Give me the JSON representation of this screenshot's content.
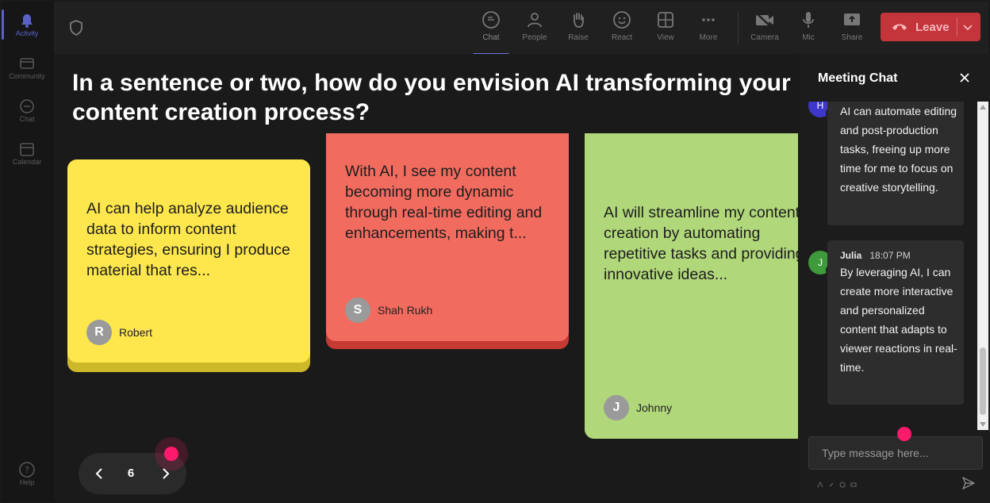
{
  "rail": {
    "items": [
      {
        "label": "Activity",
        "icon": "bell-icon",
        "active": true
      },
      {
        "label": "Community",
        "icon": "community-icon",
        "active": false
      },
      {
        "label": "Chat",
        "icon": "chat-icon",
        "active": false
      },
      {
        "label": "Calendar",
        "icon": "calendar-icon",
        "active": false
      }
    ],
    "help_label": "Help"
  },
  "toolbar": {
    "items": [
      {
        "label": "Chat",
        "icon": "chat-icon",
        "active": true
      },
      {
        "label": "People",
        "icon": "people-icon",
        "active": false
      },
      {
        "label": "Raise",
        "icon": "raise-hand-icon",
        "active": false
      },
      {
        "label": "React",
        "icon": "smiley-icon",
        "active": false
      },
      {
        "label": "View",
        "icon": "grid-icon",
        "active": false
      },
      {
        "label": "More",
        "icon": "more-dots-icon",
        "active": false
      },
      {
        "label": "Camera",
        "icon": "camera-off-icon",
        "active": false
      },
      {
        "label": "Mic",
        "icon": "mic-icon",
        "active": false
      },
      {
        "label": "Share",
        "icon": "share-icon",
        "active": false
      }
    ],
    "leave_label": "Leave"
  },
  "main": {
    "question": "In a sentence or two, how do you envision AI transforming your content creation process?",
    "cards": [
      {
        "text": "AI can help analyze audience data to inform content strategies, ensuring I produce material that res...",
        "author": "Robert",
        "initial": "R",
        "color": "#fde74c"
      },
      {
        "text": "With AI, I see my content becoming more dynamic through real-time editing and enhancements, making t...",
        "author": "Shah Rukh",
        "initial": "S",
        "color": "#f26b5f"
      },
      {
        "text": "AI will streamline my content creation by automating repetitive tasks and providing innovative ideas...",
        "author": "Johnny",
        "initial": "J",
        "color": "#b1d77b"
      }
    ],
    "page_number": "6"
  },
  "chat": {
    "title": "Meeting Chat",
    "messages": [
      {
        "sender": "",
        "time": "",
        "initial": "H",
        "avatar_color": "#3f37c9",
        "text": "AI can automate editing and post-production tasks, freeing up more time for me to focus on creative storytelling."
      },
      {
        "sender": "Julia",
        "time": "18:07 PM",
        "initial": "J",
        "avatar_color": "#3e9a3a",
        "text": "By leveraging AI, I can create more interactive and personalized content that adapts to viewer reactions in real-time."
      }
    ],
    "input_placeholder": "Type message here..."
  }
}
